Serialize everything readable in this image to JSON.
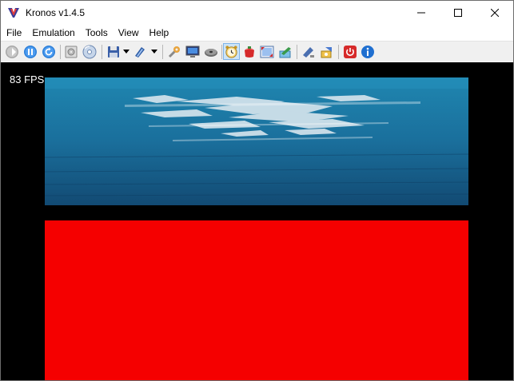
{
  "window": {
    "title": "Kronos v1.4.5",
    "app_icon": "kronos-logo-icon",
    "controls": [
      "minimize-icon",
      "maximize-icon",
      "close-icon"
    ]
  },
  "menu": {
    "items": [
      "File",
      "Emulation",
      "Tools",
      "View",
      "Help"
    ]
  },
  "toolbar": {
    "buttons": [
      "run-icon",
      "pause-icon",
      "reset-icon",
      "open-iso-icon",
      "open-cd-icon",
      "save-state-icon",
      "load-state-icon",
      "settings-icon",
      "vdp-viewer-icon",
      "cd-drive-icon",
      "frame-limit-icon",
      "screenshot-icon",
      "fullscreen-icon",
      "memory-editor-icon",
      "script-icon",
      "debug-icon",
      "power-icon",
      "about-icon"
    ],
    "active_button": "frame-limit-icon"
  },
  "display": {
    "fps_text": "83 FPS",
    "top_screen_description_color": "#1b6f98",
    "bottom_screen_color": "#f50000"
  }
}
